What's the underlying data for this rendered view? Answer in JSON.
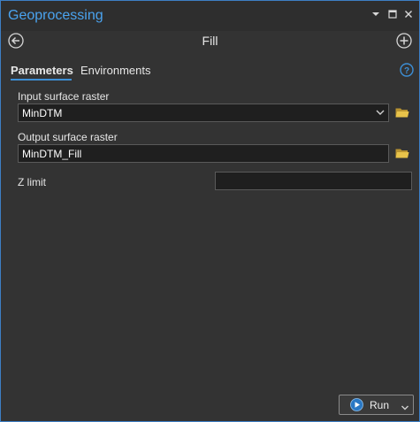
{
  "window": {
    "title": "Geoprocessing",
    "icons": [
      "chevron-down-icon",
      "maximize-icon",
      "close-icon"
    ]
  },
  "tool": {
    "name": "Fill",
    "back_icon": "back-arrow-icon",
    "add_icon": "plus-circle-icon"
  },
  "tabs": [
    {
      "label": "Parameters",
      "active": true
    },
    {
      "label": "Environments",
      "active": false
    }
  ],
  "help_icon": "question-mark-icon",
  "params": {
    "input_label": "Input surface raster",
    "input_value": "MinDTM",
    "output_label": "Output surface raster",
    "output_value": "MinDTM_Fill",
    "zlimit_label": "Z limit",
    "zlimit_value": ""
  },
  "run": {
    "label": "Run",
    "icon": "play-icon"
  },
  "colors": {
    "accent": "#3d8fd6",
    "title_text": "#4aa3ef",
    "folder": "#e8c34a",
    "background": "#333333"
  }
}
